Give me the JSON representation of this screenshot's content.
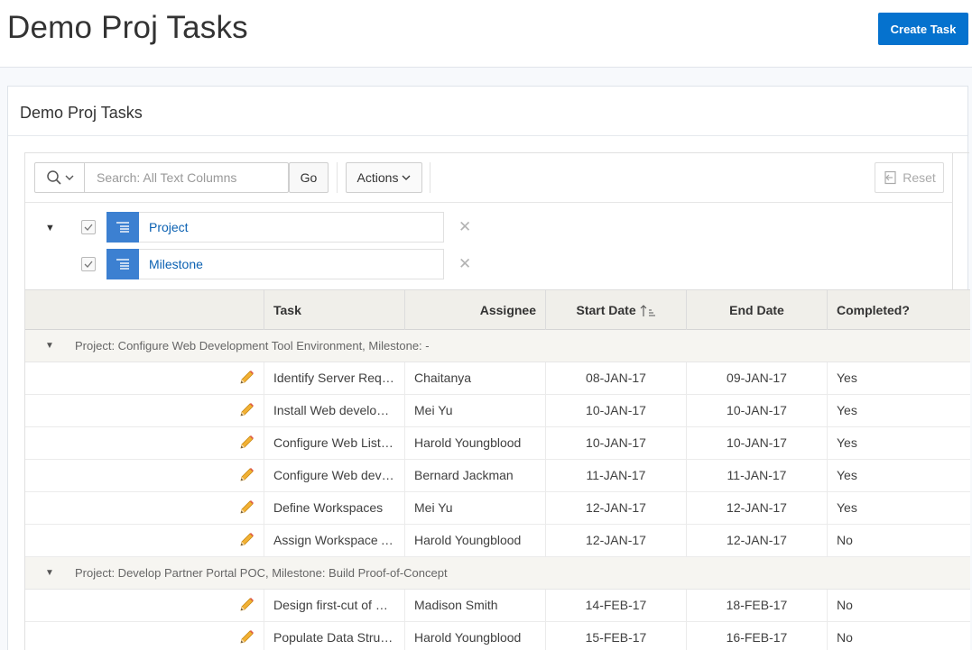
{
  "page": {
    "title": "Demo Proj Tasks",
    "create_button": "Create Task"
  },
  "region": {
    "title": "Demo Proj Tasks"
  },
  "toolbar": {
    "search_placeholder": "Search: All Text Columns",
    "go_label": "Go",
    "actions_label": "Actions",
    "reset_label": "Reset"
  },
  "controls": [
    {
      "label": "Project",
      "checked": true
    },
    {
      "label": "Milestone",
      "checked": true
    }
  ],
  "columns": [
    "Task",
    "Assignee",
    "Start Date",
    "End Date",
    "Completed?"
  ],
  "sort": {
    "column": "Start Date",
    "direction": "ascending"
  },
  "groups": [
    {
      "label": "Project: Configure Web Development Tool Environment, Milestone: -",
      "rows": [
        {
          "task": "Identify Server Requir...",
          "assignee": "Chaitanya",
          "start": "08-JAN-17",
          "end": "09-JAN-17",
          "completed": "Yes"
        },
        {
          "task": "Install Web developm...",
          "assignee": "Mei Yu",
          "start": "10-JAN-17",
          "end": "10-JAN-17",
          "completed": "Yes"
        },
        {
          "task": "Configure Web Listen...",
          "assignee": "Harold Youngblood",
          "start": "10-JAN-17",
          "end": "10-JAN-17",
          "completed": "Yes"
        },
        {
          "task": "Configure Web devel...",
          "assignee": "Bernard Jackman",
          "start": "11-JAN-17",
          "end": "11-JAN-17",
          "completed": "Yes"
        },
        {
          "task": "Define Workspaces",
          "assignee": "Mei Yu",
          "start": "12-JAN-17",
          "end": "12-JAN-17",
          "completed": "Yes"
        },
        {
          "task": "Assign Workspace Ad...",
          "assignee": "Harold Youngblood",
          "start": "12-JAN-17",
          "end": "12-JAN-17",
          "completed": "No"
        }
      ]
    },
    {
      "label": "Project: Develop Partner Portal POC, Milestone: Build Proof-of-Concept",
      "rows": [
        {
          "task": "Design first-cut of ma...",
          "assignee": "Madison Smith",
          "start": "14-FEB-17",
          "end": "18-FEB-17",
          "completed": "No"
        },
        {
          "task": "Populate Data Structu...",
          "assignee": "Harold Youngblood",
          "start": "15-FEB-17",
          "end": "16-FEB-17",
          "completed": "No"
        }
      ]
    }
  ],
  "colors": {
    "primary": "#0572ce",
    "control_badge": "#3c80d1",
    "link": "#0b61b2",
    "header_bg": "#f0efea",
    "group_bg": "#f6f5f1"
  }
}
